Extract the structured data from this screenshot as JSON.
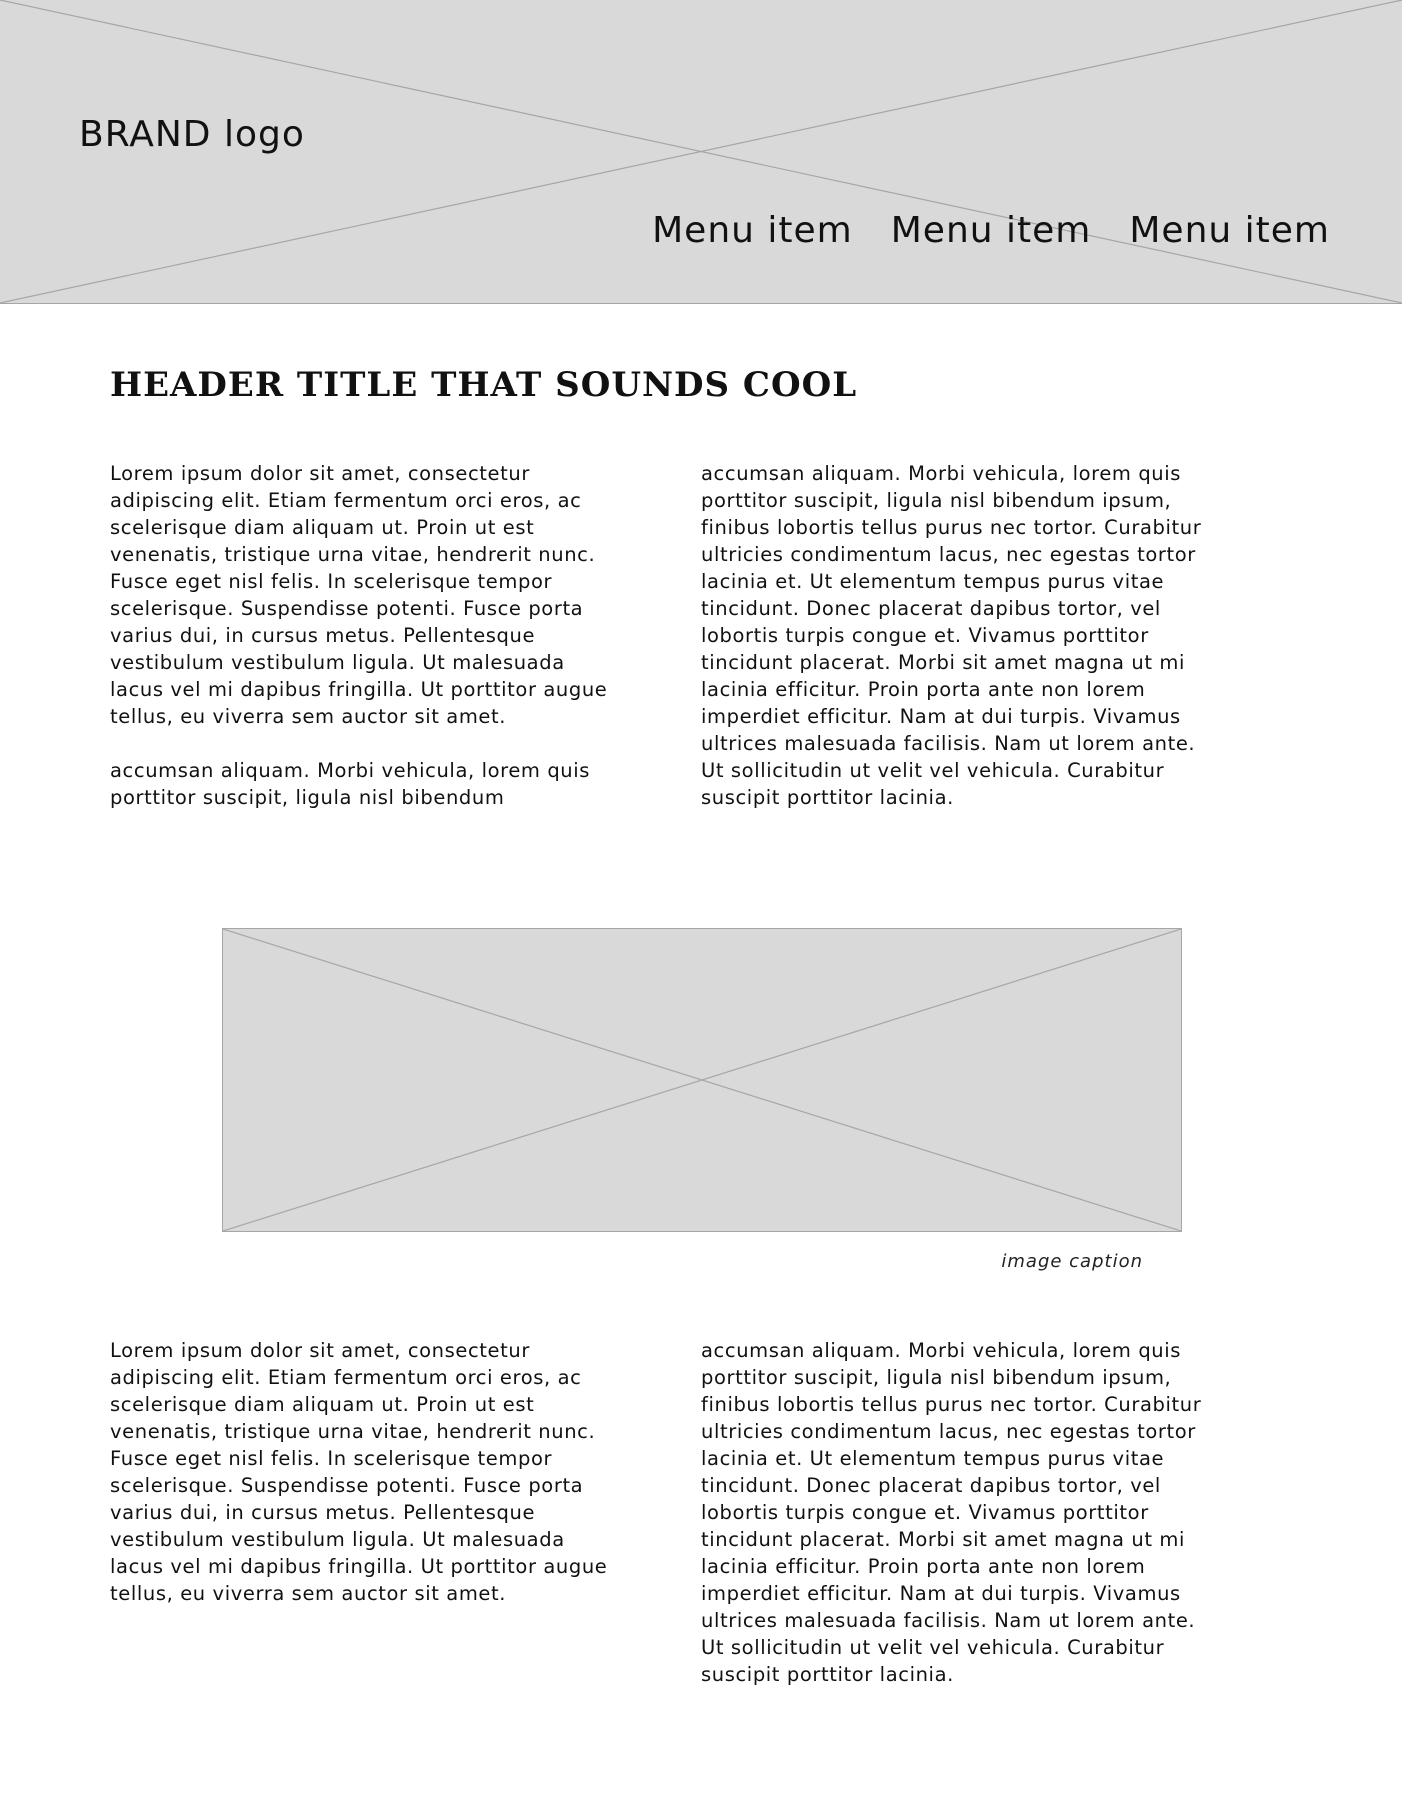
{
  "header": {
    "brand": "BRAND logo",
    "menu": [
      {
        "label": "Menu item"
      },
      {
        "label": "Menu item"
      },
      {
        "label": "Menu item"
      }
    ]
  },
  "main": {
    "title": "HEADER TITLE THAT SOUNDS COOL",
    "section1": {
      "left_paragraphs": [
        "Lorem ipsum dolor sit amet, consectetur adipiscing elit. Etiam fermentum orci eros, ac scelerisque diam aliquam ut. Proin ut est venenatis, tristique urna vitae, hendrerit nunc. Fusce eget nisl felis. In scelerisque tempor scelerisque. Suspendisse potenti. Fusce porta varius dui, in cursus metus. Pellentesque vestibulum vestibulum ligula. Ut malesuada lacus vel mi dapibus fringilla. Ut porttitor augue tellus, eu viverra sem auctor sit amet.",
        "accumsan aliquam. Morbi vehicula, lorem quis porttitor suscipit, ligula nisl bibendum"
      ],
      "right_paragraphs": [
        "accumsan aliquam. Morbi vehicula, lorem quis porttitor suscipit, ligula nisl bibendum ipsum, finibus lobortis tellus purus nec tortor. Curabitur ultricies condimentum lacus, nec egestas tortor lacinia et. Ut elementum tempus purus vitae tincidunt. Donec placerat dapibus tortor, vel lobortis turpis congue et. Vivamus porttitor tincidunt placerat. Morbi sit amet magna ut mi lacinia efficitur. Proin porta ante non lorem imperdiet efficitur. Nam at dui turpis. Vivamus ultrices malesuada facilisis. Nam ut lorem ante. Ut sollicitudin ut velit vel vehicula. Curabitur suscipit porttitor lacinia."
      ]
    },
    "image": {
      "caption": "image caption"
    },
    "section2": {
      "left_paragraphs": [
        "Lorem ipsum dolor sit amet, consectetur adipiscing elit. Etiam fermentum orci eros, ac scelerisque diam aliquam ut. Proin ut est venenatis, tristique urna vitae, hendrerit nunc. Fusce eget nisl felis. In scelerisque tempor scelerisque. Suspendisse potenti. Fusce porta varius dui, in cursus metus. Pellentesque vestibulum vestibulum ligula. Ut malesuada lacus vel mi dapibus fringilla. Ut porttitor augue tellus, eu viverra sem auctor sit amet."
      ],
      "right_paragraphs": [
        "accumsan aliquam. Morbi vehicula, lorem quis porttitor suscipit, ligula nisl bibendum ipsum, finibus lobortis tellus purus nec tortor. Curabitur ultricies condimentum lacus, nec egestas tortor lacinia et. Ut elementum tempus purus vitae tincidunt. Donec placerat dapibus tortor, vel lobortis turpis congue et. Vivamus porttitor tincidunt placerat. Morbi sit amet magna ut mi lacinia efficitur. Proin porta ante non lorem imperdiet efficitur. Nam at dui turpis. Vivamus ultrices malesuada facilisis. Nam ut lorem ante. Ut sollicitudin ut velit vel vehicula. Curabitur suscipit porttitor lacinia."
      ]
    }
  },
  "colors": {
    "placeholder_fill": "#d9d9d9",
    "placeholder_line": "#a6a6a6",
    "text": "#111111",
    "background": "#ffffff"
  }
}
